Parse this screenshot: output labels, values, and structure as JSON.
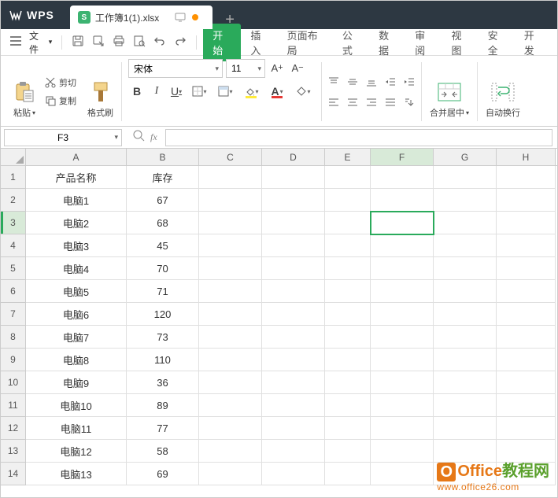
{
  "app": {
    "name": "WPS"
  },
  "tab": {
    "filename": "工作簿1(1).xlsx",
    "doc_badge": "S"
  },
  "menu": {
    "file": "文件",
    "tabs": [
      "开始",
      "插入",
      "页面布局",
      "公式",
      "数据",
      "审阅",
      "视图",
      "安全",
      "开发"
    ],
    "active_index": 0
  },
  "ribbon": {
    "paste": "粘贴",
    "cut": "剪切",
    "copy": "复制",
    "format_painter": "格式刷",
    "font_name": "宋体",
    "font_size": "11",
    "merge_center": "合并居中",
    "auto_wrap": "自动换行"
  },
  "namebox": "F3",
  "columns": [
    "A",
    "B",
    "C",
    "D",
    "E",
    "F",
    "G",
    "H"
  ],
  "selected_col_index": 5,
  "selected_row_index": 2,
  "rows": [
    {
      "n": "1",
      "a": "产品名称",
      "b": "库存"
    },
    {
      "n": "2",
      "a": "电脑1",
      "b": "67"
    },
    {
      "n": "3",
      "a": "电脑2",
      "b": "68"
    },
    {
      "n": "4",
      "a": "电脑3",
      "b": "45"
    },
    {
      "n": "5",
      "a": "电脑4",
      "b": "70"
    },
    {
      "n": "6",
      "a": "电脑5",
      "b": "71"
    },
    {
      "n": "7",
      "a": "电脑6",
      "b": "120"
    },
    {
      "n": "8",
      "a": "电脑7",
      "b": "73"
    },
    {
      "n": "9",
      "a": "电脑8",
      "b": "110"
    },
    {
      "n": "10",
      "a": "电脑9",
      "b": "36"
    },
    {
      "n": "11",
      "a": "电脑10",
      "b": "89"
    },
    {
      "n": "12",
      "a": "电脑11",
      "b": "77"
    },
    {
      "n": "13",
      "a": "电脑12",
      "b": "58"
    },
    {
      "n": "14",
      "a": "电脑13",
      "b": "69"
    }
  ],
  "watermark": {
    "brand_o": "O",
    "brand_office": "Office",
    "brand_suffix": "教程网",
    "url": "www.office26.com"
  }
}
